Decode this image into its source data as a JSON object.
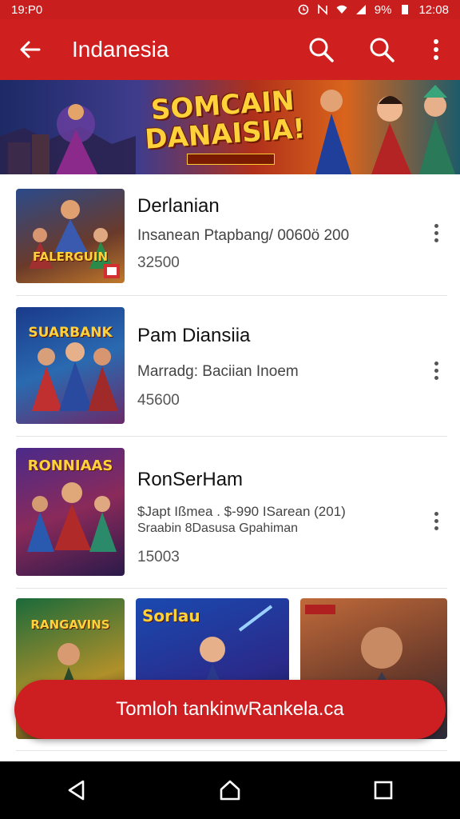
{
  "status_bar": {
    "time_left": "19:P0",
    "battery": "9%",
    "time_right": "12:08"
  },
  "app_bar": {
    "title": "Indanesia"
  },
  "banner": {
    "title": "SOMCAIN DANAISIA!"
  },
  "items": [
    {
      "name": "Derlanian",
      "description": "Insanean Ptapbang/ 0060ö 200",
      "count": "32500",
      "art_label": "FALERGUIN"
    },
    {
      "name": "Pam Diansiia",
      "description": "Marradg: Baciian Inoem",
      "count": "45600",
      "art_label": "SUARBANK"
    },
    {
      "name": "RonSerHam",
      "description": "$Japt Ißmea . $-990 ISarean (201)",
      "description2": "Sraabin 8Dasusa Gpahiman",
      "count": "15003",
      "art_label": "RONNIAAS"
    }
  ],
  "bottom_row": [
    {
      "art_label": "RANGAVINS"
    },
    {
      "art_label": "Sorlau"
    },
    {
      "art_label": ""
    }
  ],
  "fab": {
    "label": "Tomloh tankinwRankela.ca"
  },
  "colors": {
    "primary": "#cf1f1f",
    "status": "#c81e1e",
    "nav": "#000000"
  }
}
